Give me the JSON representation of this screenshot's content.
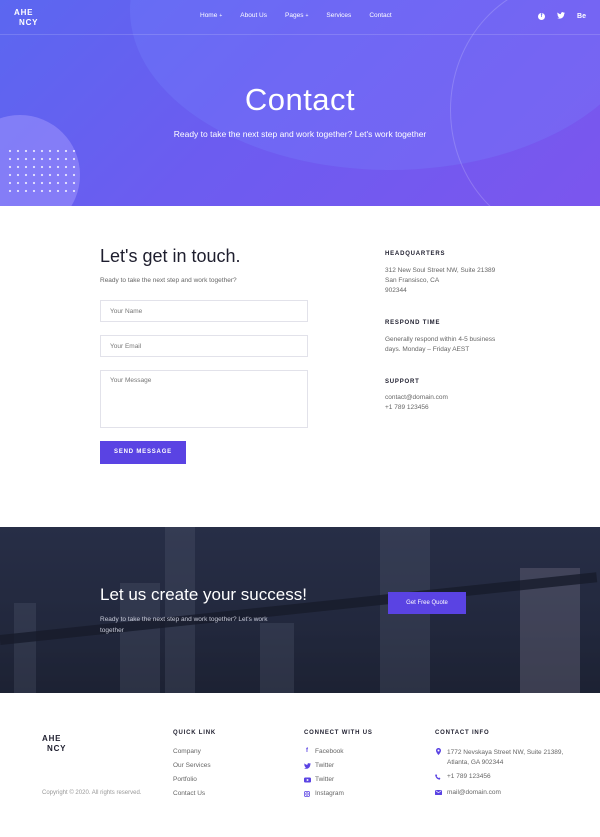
{
  "brand": {
    "logo_line1": "AHE",
    "logo_line2": "NCY"
  },
  "nav": {
    "items": [
      "Home",
      "About Us",
      "Pages",
      "Services",
      "Contact"
    ],
    "caret": "+"
  },
  "socials": {
    "facebook": "f",
    "twitter": "t",
    "behance": "Be"
  },
  "hero": {
    "title": "Contact",
    "subtitle": "Ready to take the next step and work together? Let's work together"
  },
  "contact": {
    "title": "Let's get in touch.",
    "subtitle": "Ready to take the next step and work together?",
    "name_placeholder": "Your Name",
    "email_placeholder": "Your Email",
    "message_placeholder": "Your Message",
    "send_label": "SEND MESSAGE"
  },
  "info": {
    "hq_heading": "HEADQUARTERS",
    "hq_line1": "312 New Soul Street NW, Suite 21389",
    "hq_line2": "San Fransisco, CA",
    "hq_line3": "902344",
    "respond_heading": "RESPOND TIME",
    "respond_line1": "Generally respond within 4-5 business",
    "respond_line2": "days. Monday – Friday AEST",
    "support_heading": "SUPPORT",
    "support_email": "contact@domain.com",
    "support_phone": "+1 789 123456"
  },
  "cta": {
    "title": "Let us create your success!",
    "subtitle": "Ready to take the next step and work together? Let's work together",
    "button_label": "Get Free Quote"
  },
  "footer": {
    "copyright": "Copyright © 2020. All rights reserved.",
    "quick_heading": "QUICK LINK",
    "quick_links": [
      "Company",
      "Our Services",
      "Portfolio",
      "Contact Us"
    ],
    "connect_heading": "CONNECT WITH US",
    "connect_links": [
      "Facebook",
      "Twitter",
      "Twitter",
      "Instagram"
    ],
    "contact_heading": "CONTACT INFO",
    "contact_address1": "1772 Nevskaya Street NW, Suite 21389,",
    "contact_address2": "Atlanta, GA 902344",
    "contact_phone": "+1 789 123456",
    "contact_email": "mail@domain.com"
  },
  "colors": {
    "accent": "#5a43e3",
    "hero_start": "#5b67f0",
    "hero_end": "#7b56ee",
    "cta_bg": "#262c42"
  },
  "icons": [
    "facebook-icon",
    "twitter-icon",
    "behance-icon",
    "youtube-icon",
    "instagram-icon",
    "map-pin-icon",
    "phone-icon",
    "mail-icon"
  ]
}
